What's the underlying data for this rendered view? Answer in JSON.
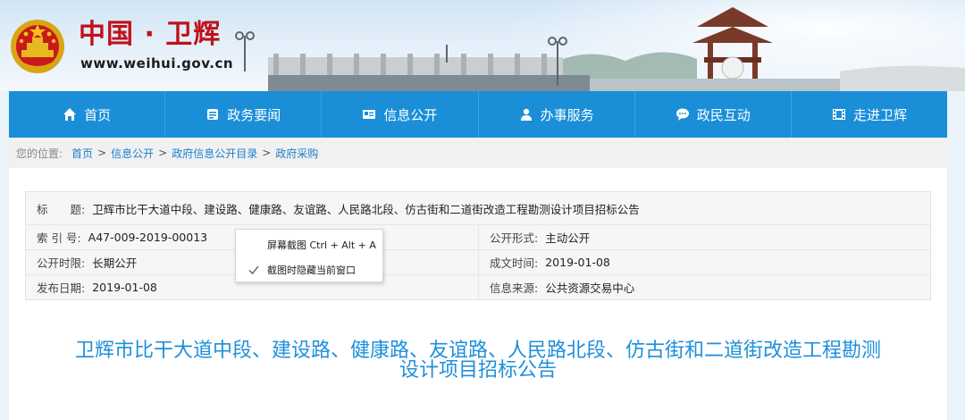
{
  "header": {
    "site_title": "中国 · 卫辉",
    "site_url": "www.weihui.gov.cn"
  },
  "nav": {
    "items": [
      {
        "label": "首页",
        "icon": "home-icon"
      },
      {
        "label": "政务要闻",
        "icon": "news-icon"
      },
      {
        "label": "信息公开",
        "icon": "info-card-icon"
      },
      {
        "label": "办事服务",
        "icon": "user-service-icon"
      },
      {
        "label": "政民互动",
        "icon": "chat-icon"
      },
      {
        "label": "走进卫辉",
        "icon": "film-icon"
      }
    ],
    "background": "#1a8fd8"
  },
  "breadcrumb": {
    "prefix": "您的位置:",
    "items": [
      "首页",
      "信息公开",
      "政府信息公开目录",
      "政府采购"
    ],
    "separator": ">"
  },
  "meta": {
    "title_key": "标　　题:",
    "title_value": "卫辉市比干大道中段、建设路、健康路、友谊路、人民路北段、仿古街和二道街改造工程勘测设计项目招标公告",
    "rows": [
      {
        "left_key": "索 引 号:",
        "left_value": "A47-009-2019-00013",
        "right_key": "公开形式:",
        "right_value": "主动公开"
      },
      {
        "left_key": "公开时限:",
        "left_value": "长期公开",
        "right_key": "成文时间:",
        "right_value": "2019-01-08"
      },
      {
        "left_key": "发布日期:",
        "left_value": "2019-01-08",
        "right_key": "信息来源:",
        "right_value": "公共资源交易中心"
      }
    ]
  },
  "document": {
    "title_line1": "卫辉市比干大道中段、建设路、健康路、友谊路、人民路北段、仿古街和二道街改造工程勘测",
    "title_line2": "设计项目招标公告",
    "color": "#1e8fda"
  },
  "context_menu": {
    "items": [
      {
        "label": "屏幕截图 Ctrl + Alt + A",
        "checked": false
      },
      {
        "label": "截图时隐藏当前窗口",
        "checked": true
      }
    ]
  }
}
